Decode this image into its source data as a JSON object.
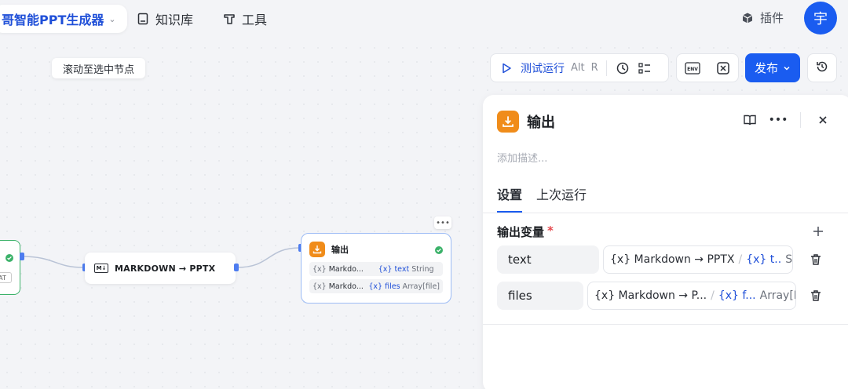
{
  "topbar": {
    "app_title": "哥智能PPT生成器",
    "nav": [
      {
        "label": "知识库",
        "icon": "book-icon"
      },
      {
        "label": "工具",
        "icon": "tool-icon"
      }
    ],
    "plugin_label": "插件",
    "avatar_char": "宇"
  },
  "canvas": {
    "scroll_hint": "滚动至选中节点",
    "nodes": {
      "left_tag": "AT",
      "markdown": {
        "badge": "M↓",
        "title": "MARKDOWN → PPTX"
      },
      "output": {
        "title": "输出",
        "rows": [
          {
            "source": "Markdo...",
            "var": "text",
            "type": "String"
          },
          {
            "source": "Markdo...",
            "var": "files",
            "type": "Array[file]"
          }
        ]
      }
    }
  },
  "toolbar": {
    "test_run_label": "测试运行",
    "shortcut_alt": "Alt",
    "shortcut_key": "R",
    "publish_label": "发布",
    "env_label": "ENV"
  },
  "panel": {
    "title": "输出",
    "description_placeholder": "添加描述...",
    "tabs": [
      {
        "label": "设置",
        "active": true
      },
      {
        "label": "上次运行",
        "active": false
      }
    ],
    "section_title": "输出变量",
    "required_mark": "*",
    "outputs": [
      {
        "name": "text",
        "source": "{x} Markdown → PPTX",
        "slash": "/",
        "var": "{x} t..",
        "type": "String"
      },
      {
        "name": "files",
        "source": "{x} Markdown → P...",
        "slash": "/",
        "var": "{x} f...",
        "type": "Array[File]"
      }
    ]
  },
  "colors": {
    "primary": "#1a5cf0",
    "node_orange": "#f08c1a",
    "success": "#3cb26a"
  }
}
